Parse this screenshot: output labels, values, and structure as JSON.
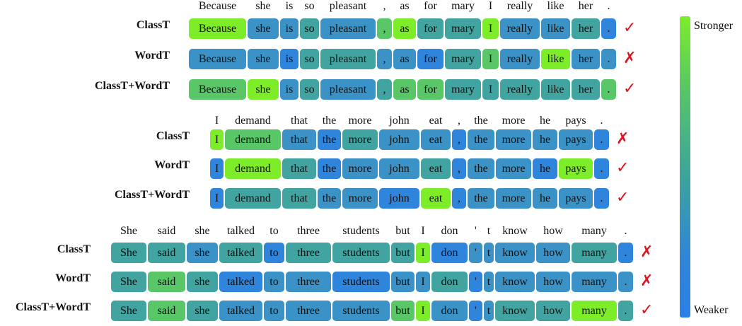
{
  "colors": {
    "s": "#7ded2a",
    "g": "#59c768",
    "t": "#41a4a0",
    "b": "#3a92c6",
    "d": "#2f84dc",
    "mark": "#e0141e"
  },
  "colorbar": {
    "top_label": "Stronger",
    "bottom_label": "Weaker"
  },
  "groups": [
    {
      "tokens": [
        "Because",
        "she",
        "is",
        "so",
        "pleasant",
        ",",
        "as",
        "for",
        "mary",
        "I",
        "really",
        "like",
        "her",
        "."
      ],
      "rows": [
        {
          "label": "ClassT",
          "colors": [
            "s",
            "b",
            "b",
            "t",
            "b",
            "g",
            "s",
            "t",
            "t",
            "s",
            "b",
            "b",
            "t",
            "d"
          ],
          "mark": "✓"
        },
        {
          "label": "WordT",
          "colors": [
            "b",
            "b",
            "d",
            "t",
            "t",
            "b",
            "b",
            "d",
            "t",
            "g",
            "b",
            "s",
            "b",
            "b"
          ],
          "mark": "✗"
        },
        {
          "label": "ClassT+WordT",
          "colors": [
            "g",
            "s",
            "b",
            "t",
            "b",
            "t",
            "g",
            "g",
            "t",
            "t",
            "t",
            "t",
            "t",
            "g"
          ],
          "mark": "✓"
        }
      ]
    },
    {
      "tokens": [
        "I",
        "demand",
        "that",
        "the",
        "more",
        "john",
        "eat",
        ",",
        "the",
        "more",
        "he",
        "pays",
        "."
      ],
      "rows": [
        {
          "label": "ClassT",
          "colors": [
            "s",
            "g",
            "b",
            "d",
            "t",
            "b",
            "b",
            "d",
            "b",
            "b",
            "b",
            "b",
            "d"
          ],
          "mark": "✗"
        },
        {
          "label": "WordT",
          "colors": [
            "d",
            "s",
            "t",
            "d",
            "b",
            "b",
            "t",
            "d",
            "b",
            "b",
            "d",
            "s",
            "d"
          ],
          "mark": "✓"
        },
        {
          "label": "ClassT+WordT",
          "colors": [
            "d",
            "t",
            "t",
            "b",
            "b",
            "d",
            "s",
            "d",
            "b",
            "b",
            "b",
            "b",
            "d"
          ],
          "mark": "✓"
        }
      ]
    },
    {
      "tokens": [
        "She",
        "said",
        "she",
        "talked",
        "to",
        "three",
        "students",
        "but",
        "I",
        "don",
        "'",
        "t",
        "know",
        "how",
        "many",
        "."
      ],
      "rows": [
        {
          "label": "ClassT",
          "colors": [
            "t",
            "t",
            "b",
            "t",
            "d",
            "t",
            "t",
            "t",
            "s",
            "d",
            "b",
            "b",
            "b",
            "b",
            "t",
            "d"
          ],
          "mark": "✗"
        },
        {
          "label": "WordT",
          "colors": [
            "t",
            "g",
            "t",
            "d",
            "b",
            "b",
            "d",
            "b",
            "b",
            "t",
            "d",
            "b",
            "b",
            "b",
            "b",
            "b"
          ],
          "mark": "✗"
        },
        {
          "label": "ClassT+WordT",
          "colors": [
            "t",
            "g",
            "t",
            "b",
            "b",
            "b",
            "b",
            "g",
            "s",
            "b",
            "d",
            "b",
            "t",
            "t",
            "s",
            "t"
          ],
          "mark": "✓"
        }
      ]
    }
  ]
}
